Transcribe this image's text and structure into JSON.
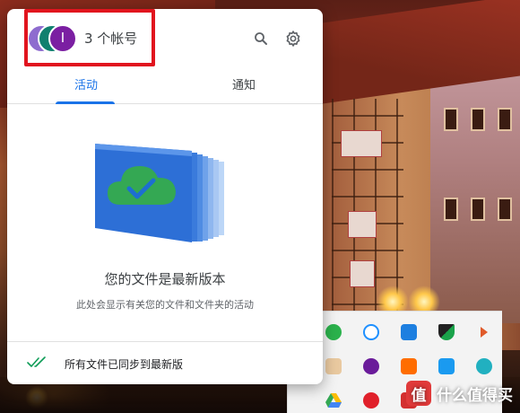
{
  "popup": {
    "account_count": "3 个帐号",
    "avatar_initial": "I",
    "tabs": [
      {
        "label": "活动",
        "active": true
      },
      {
        "label": "通知",
        "active": false
      }
    ],
    "status_title": "您的文件是最新版本",
    "status_subtitle": "此处会显示有关您的文件和文件夹的活动",
    "footer_text": "所有文件已同步到最新版"
  },
  "colors": {
    "accent": "#1a73e8",
    "highlight_box": "#e1141e",
    "check_green": "#0f9d58"
  },
  "tray": {
    "icons": [
      "wechat-icon",
      "bubble-icon",
      "pin-icon",
      "defender-icon",
      "volume-icon",
      "cat-icon",
      "v-icon",
      "leaf-icon",
      "upload-icon",
      "network-icon",
      "google-drive-icon",
      "netease-icon",
      "red-icon",
      "",
      ""
    ]
  },
  "watermark": {
    "badge": "值",
    "text": "什么值得买"
  }
}
